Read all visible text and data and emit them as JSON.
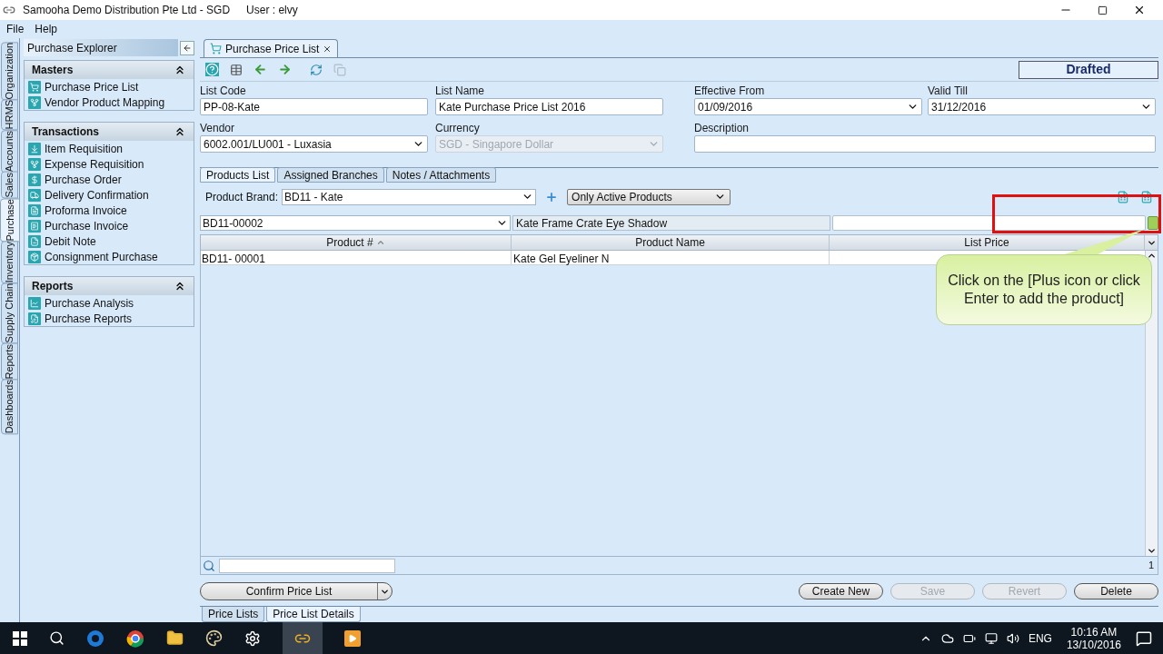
{
  "window": {
    "title": "Samooha Demo Distribution Pte Ltd - SGD",
    "user": "User : elvy"
  },
  "menu": [
    "File",
    "Help"
  ],
  "side_tabs": [
    {
      "label": "Organization",
      "selected": false
    },
    {
      "label": "HRMS",
      "selected": false
    },
    {
      "label": "Accounts",
      "selected": false
    },
    {
      "label": "Sales",
      "selected": false
    },
    {
      "label": "Purchase",
      "selected": true
    },
    {
      "label": "Inventory",
      "selected": false
    },
    {
      "label": "Supply Chain",
      "selected": false
    },
    {
      "label": "Reports",
      "selected": false
    },
    {
      "label": "Dashboards",
      "selected": false
    }
  ],
  "explorer": {
    "title": "Purchase Explorer",
    "sections": [
      {
        "title": "Masters",
        "expanded": true,
        "items": [
          "Purchase Price List",
          "Vendor Product Mapping"
        ]
      },
      {
        "title": "Transactions",
        "expanded": true,
        "items": [
          "Item Requisition",
          "Expense Requisition",
          "Purchase Order",
          "Delivery Confirmation",
          "Proforma Invoice",
          "Purchase Invoice",
          "Debit Note",
          "Consignment Purchase"
        ]
      },
      {
        "title": "Reports",
        "expanded": true,
        "items": [
          "Purchase Analysis",
          "Purchase Reports"
        ]
      }
    ]
  },
  "doc_tab": {
    "label": "Purchase Price List"
  },
  "status": "Drafted",
  "fields": [
    {
      "label": "List Code",
      "value": "PP-08-Kate",
      "kind": "text",
      "disabled": false
    },
    {
      "label": "List Name",
      "value": "Kate Purchase Price List 2016",
      "kind": "text",
      "disabled": false
    },
    {
      "label": "Effective From",
      "value": "01/09/2016",
      "kind": "select",
      "disabled": false
    },
    {
      "label": "Valid Till",
      "value": "31/12/2016",
      "kind": "select",
      "disabled": false
    },
    {
      "label": "Vendor",
      "value": "6002.001/LU001 - Luxasia",
      "kind": "select",
      "disabled": false
    },
    {
      "label": "Currency",
      "value": "SGD - Singapore Dollar",
      "kind": "select",
      "disabled": true
    },
    {
      "label": "Description",
      "kind": "text",
      "disabled": false
    }
  ],
  "sub_tabs": [
    {
      "label": "Products List",
      "selected": true
    },
    {
      "label": "Assigned Branches",
      "selected": false
    },
    {
      "label": "Notes / Attachments",
      "selected": false
    }
  ],
  "brand": {
    "label": "Product Brand:",
    "value": "BD11 - Kate"
  },
  "filter": "Only Active Products",
  "entry": {
    "code": "BD11-00002",
    "name": "Kate Frame Crate Eye Shadow"
  },
  "table": {
    "columns": [
      "Product #",
      "Product Name",
      "List Price"
    ],
    "rows": [
      {
        "code": "BD11- 00001",
        "name": "Kate Gel Eyeliner N"
      }
    ]
  },
  "row_count": "1",
  "callout": "Click on the [Plus icon or click Enter to add the product]",
  "confirm_button": "Confirm Price List",
  "actions": [
    {
      "label": "Create New",
      "disabled": false
    },
    {
      "label": "Save",
      "disabled": true
    },
    {
      "label": "Revert",
      "disabled": true
    },
    {
      "label": "Delete",
      "disabled": false
    }
  ],
  "bottom_tabs": [
    {
      "label": "Price Lists",
      "selected": false
    },
    {
      "label": "Price List Details",
      "selected": true
    }
  ],
  "taskbar": {
    "language": "ENG",
    "time": "10:16 AM",
    "date": "13/10/2016"
  }
}
